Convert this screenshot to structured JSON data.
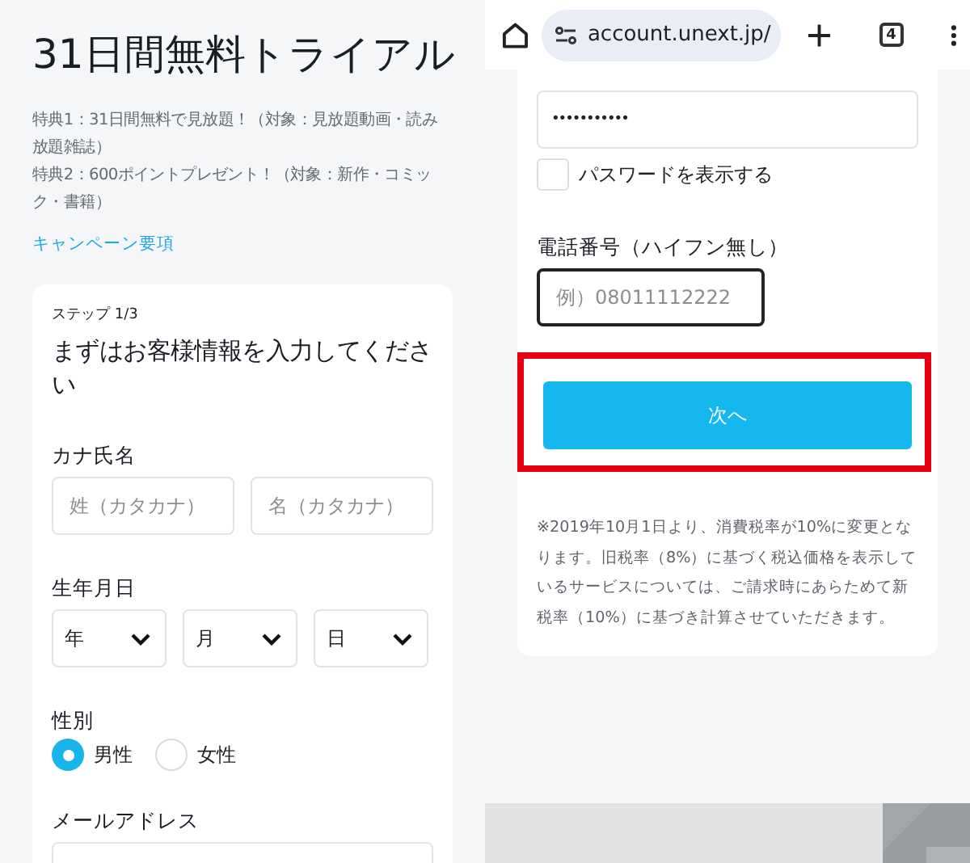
{
  "left": {
    "title": "31日間無料トライアル",
    "benefits": [
      "特典1：31日間無料で見放題！（対象：見放題動画・読み放題雑誌）",
      "特典2：600ポイントプレゼント！（対象：新作・コミック・書籍）"
    ],
    "campaign_link": "キャンペーン要項",
    "form": {
      "step": "ステップ 1/3",
      "heading": "まずはお客様情報を入力してください",
      "kana": {
        "label": "カナ氏名",
        "fields": [
          {
            "placeholder": "姓（カタカナ）"
          },
          {
            "placeholder": "名（カタカナ）"
          }
        ]
      },
      "birthdate": {
        "label": "生年月日",
        "selects": [
          "年",
          "月",
          "日"
        ]
      },
      "gender": {
        "label": "性別",
        "options": [
          {
            "label": "男性",
            "selected": true
          },
          {
            "label": "女性",
            "selected": false
          }
        ]
      },
      "email": {
        "label": "メールアドレス"
      }
    }
  },
  "right": {
    "browser": {
      "url": "account.unext.jp/",
      "tab_count": "4"
    },
    "password": {
      "value": "•••••••••••"
    },
    "show_password": {
      "label": "パスワードを表示する",
      "checked": false
    },
    "phone": {
      "label": "電話番号（ハイフン無し）",
      "placeholder": "例）08011112222",
      "focused": true
    },
    "next_button": {
      "label": "次へ",
      "highlighted": true
    },
    "note": "※2019年10月1日より、消費税率が10%に変更となります。旧税率（8%）に基づく税込価格を表示しているサービスについては、ご請求時にあらためて新税率（10%）に基づき計算させていただきます。"
  }
}
